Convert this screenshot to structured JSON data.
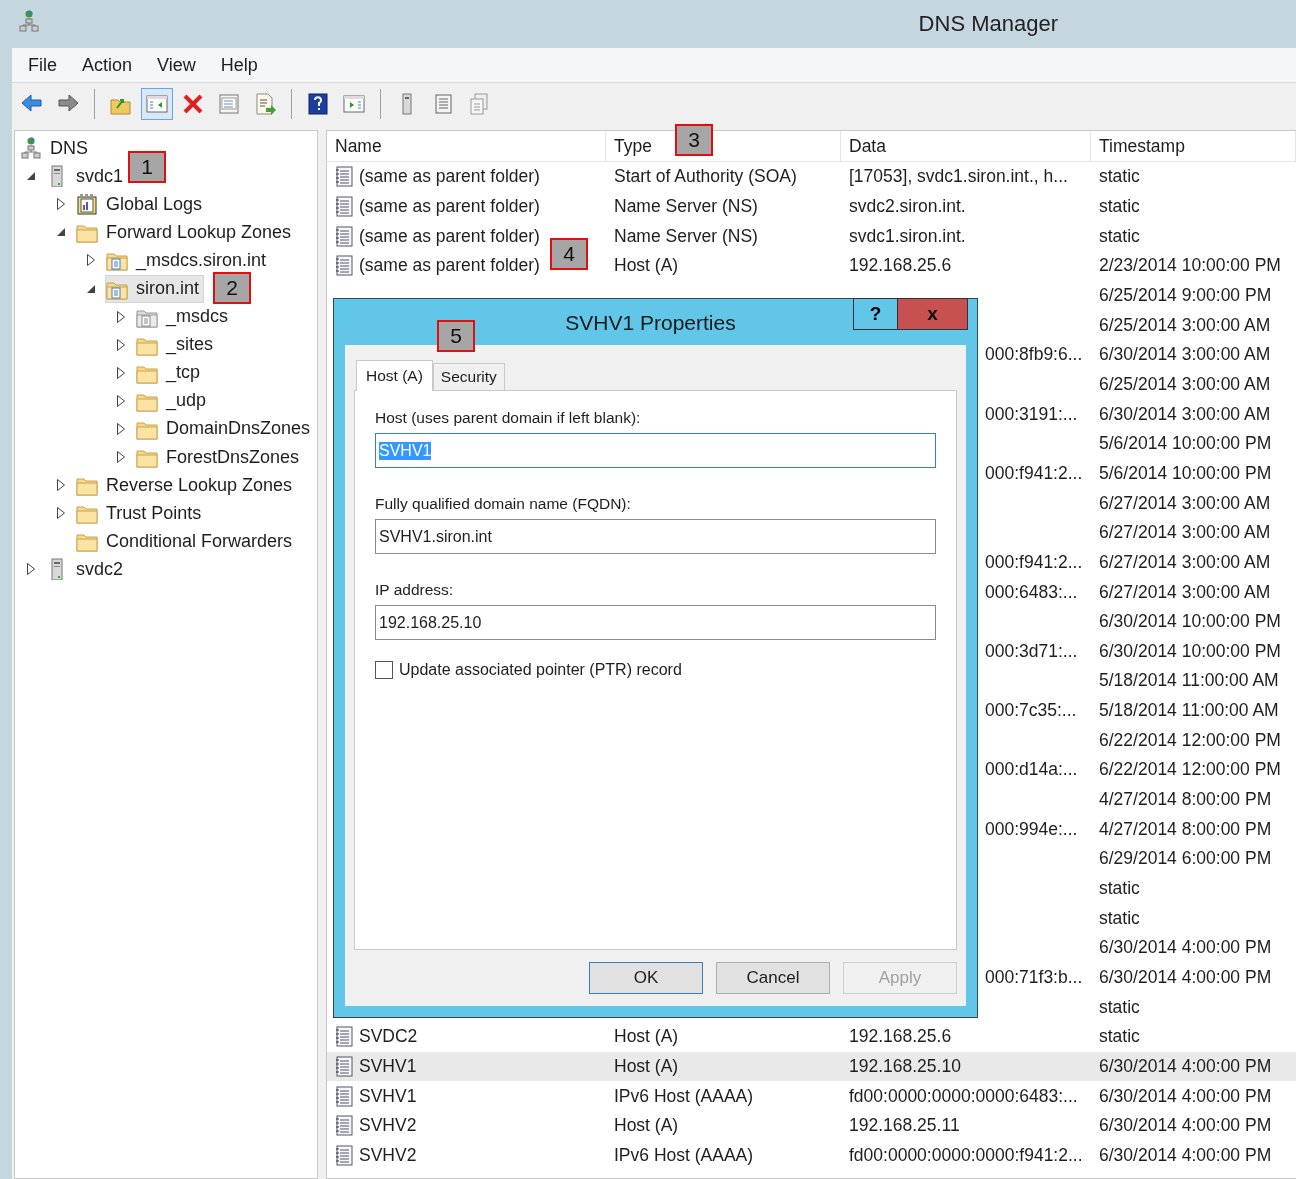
{
  "window": {
    "title": "DNS Manager"
  },
  "menu": [
    "File",
    "Action",
    "View",
    "Help"
  ],
  "toolbar": [
    [
      {
        "pressed": false
      },
      {
        "pressed": false
      }
    ],
    [
      {
        "pressed": false
      },
      {
        "pressed": true
      },
      {
        "pressed": false
      },
      {
        "pressed": false
      },
      {
        "pressed": false
      }
    ],
    [
      {
        "pressed": false
      },
      {
        "pressed": false
      }
    ],
    [
      {
        "pressed": false
      },
      {
        "pressed": false
      },
      {
        "pressed": false
      }
    ]
  ],
  "tree": [
    {
      "label": "DNS",
      "kind": "dns",
      "selected": false,
      "children": [
        {
          "label": "svdc1",
          "kind": "server",
          "expanded": true,
          "selected": false,
          "children": [
            {
              "label": "Global Logs",
              "kind": "log",
              "expanded": false,
              "selected": false
            },
            {
              "label": "Forward Lookup Zones",
              "kind": "folder",
              "expanded": true,
              "selected": false,
              "children": [
                {
                  "label": "_msdcs.siron.int",
                  "kind": "zone",
                  "expanded": false,
                  "selected": false
                },
                {
                  "label": "siron.int",
                  "kind": "zone",
                  "expanded": true,
                  "selected": true,
                  "children": [
                    {
                      "label": "_msdcs",
                      "kind": "delegation",
                      "expanded": false,
                      "selected": false
                    },
                    {
                      "label": "_sites",
                      "kind": "folder",
                      "expanded": false,
                      "selected": false
                    },
                    {
                      "label": "_tcp",
                      "kind": "folder",
                      "expanded": false,
                      "selected": false
                    },
                    {
                      "label": "_udp",
                      "kind": "folder",
                      "expanded": false,
                      "selected": false
                    },
                    {
                      "label": "DomainDnsZones",
                      "kind": "folder",
                      "expanded": false,
                      "selected": false
                    },
                    {
                      "label": "ForestDnsZones",
                      "kind": "folder",
                      "expanded": false,
                      "selected": false
                    }
                  ]
                }
              ]
            },
            {
              "label": "Reverse Lookup Zones",
              "kind": "folder",
              "expanded": false,
              "selected": false
            },
            {
              "label": "Trust Points",
              "kind": "folder",
              "expanded": false,
              "selected": false
            },
            {
              "label": "Conditional Forwarders",
              "kind": "folder",
              "selected": false
            }
          ]
        },
        {
          "label": "svdc2",
          "kind": "server",
          "expanded": false,
          "selected": false
        }
      ]
    }
  ],
  "table": {
    "columns": [
      "Name",
      "Type",
      "Data",
      "Timestamp"
    ],
    "rows": [
      {
        "name": "(same as parent folder)",
        "type": "Start of Authority (SOA)",
        "data": "[17053], svdc1.siron.int., h...",
        "timestamp": "static",
        "selected": false
      },
      {
        "name": "(same as parent folder)",
        "type": "Name Server (NS)",
        "data": "svdc2.siron.int.",
        "timestamp": "static",
        "selected": false
      },
      {
        "name": "(same as parent folder)",
        "type": "Name Server (NS)",
        "data": "svdc1.siron.int.",
        "timestamp": "static",
        "selected": false
      },
      {
        "name": "(same as parent folder)",
        "type": "Host (A)",
        "data": "192.168.25.6",
        "timestamp": "2/23/2014 10:00:00 PM",
        "selected": false
      },
      {
        "timestamp": "6/25/2014 9:00:00 PM",
        "selected": false
      },
      {
        "timestamp": "6/25/2014 3:00:00 AM",
        "selected": false
      },
      {
        "data": "000:8fb9:6...",
        "timestamp": "6/30/2014 3:00:00 AM",
        "selected": false
      },
      {
        "timestamp": "6/25/2014 3:00:00 AM",
        "selected": false
      },
      {
        "data": "000:3191:...",
        "timestamp": "6/30/2014 3:00:00 AM",
        "selected": false
      },
      {
        "timestamp": "5/6/2014 10:00:00 PM",
        "selected": false
      },
      {
        "data": "000:f941:2...",
        "timestamp": "5/6/2014 10:00:00 PM",
        "selected": false
      },
      {
        "timestamp": "6/27/2014 3:00:00 AM",
        "selected": false
      },
      {
        "timestamp": "6/27/2014 3:00:00 AM",
        "selected": false
      },
      {
        "data": "000:f941:2...",
        "timestamp": "6/27/2014 3:00:00 AM",
        "selected": false
      },
      {
        "data": "000:6483:...",
        "timestamp": "6/27/2014 3:00:00 AM",
        "selected": false
      },
      {
        "timestamp": "6/30/2014 10:00:00 PM",
        "selected": false
      },
      {
        "data": "000:3d71:...",
        "timestamp": "6/30/2014 10:00:00 PM",
        "selected": false
      },
      {
        "timestamp": "5/18/2014 11:00:00 AM",
        "selected": false
      },
      {
        "data": "000:7c35:...",
        "timestamp": "5/18/2014 11:00:00 AM",
        "selected": false
      },
      {
        "timestamp": "6/22/2014 12:00:00 PM",
        "selected": false
      },
      {
        "data": "000:d14a:...",
        "timestamp": "6/22/2014 12:00:00 PM",
        "selected": false
      },
      {
        "timestamp": "4/27/2014 8:00:00 PM",
        "selected": false
      },
      {
        "data": "000:994e:...",
        "timestamp": "4/27/2014 8:00:00 PM",
        "selected": false
      },
      {
        "timestamp": "6/29/2014 6:00:00 PM",
        "selected": false
      },
      {
        "timestamp": "static",
        "selected": false
      },
      {
        "timestamp": "static",
        "selected": false
      },
      {
        "timestamp": "6/30/2014 4:00:00 PM",
        "selected": false
      },
      {
        "data": "000:71f3:b...",
        "timestamp": "6/30/2014 4:00:00 PM",
        "selected": false
      },
      {
        "timestamp": "static",
        "selected": false
      },
      {
        "name": "SVDC2",
        "type": "Host (A)",
        "data": "192.168.25.6",
        "timestamp": "static",
        "selected": false
      },
      {
        "name": "SVHV1",
        "type": "Host (A)",
        "data": "192.168.25.10",
        "timestamp": "6/30/2014 4:00:00 PM",
        "selected": true
      },
      {
        "name": "SVHV1",
        "type": "IPv6 Host (AAAA)",
        "data": "fd00:0000:0000:0000:6483:...",
        "timestamp": "6/30/2014 4:00:00 PM",
        "selected": false
      },
      {
        "name": "SVHV2",
        "type": "Host (A)",
        "data": "192.168.25.11",
        "timestamp": "6/30/2014 4:00:00 PM",
        "selected": false
      },
      {
        "name": "SVHV2",
        "type": "IPv6 Host (AAAA)",
        "data": "fd00:0000:0000:0000:f941:2...",
        "timestamp": "6/30/2014 4:00:00 PM",
        "selected": false
      }
    ]
  },
  "dialog": {
    "title": "SVHV1 Properties",
    "help_button": "?",
    "close_button": "x",
    "tabs": [
      {
        "label": "Host (A)",
        "selected": true
      },
      {
        "label": "Security",
        "selected": false
      }
    ],
    "fields": [
      {
        "label": "Host (uses parent domain if left blank):",
        "value": "SVHV1",
        "focused": true
      },
      {
        "label": "Fully qualified domain name (FQDN):",
        "value": "SVHV1.siron.int",
        "focused": false
      },
      {
        "label": "IP address:",
        "value": "192.168.25.10",
        "focused": false
      }
    ],
    "checkbox": {
      "label": "Update associated pointer (PTR) record",
      "checked": false
    },
    "buttons": [
      {
        "label": "OK",
        "default": true,
        "disabled": false
      },
      {
        "label": "Cancel",
        "default": false,
        "disabled": false
      },
      {
        "label": "Apply",
        "default": false,
        "disabled": true
      }
    ]
  },
  "callouts": [
    {
      "label": "1"
    },
    {
      "label": "2"
    },
    {
      "label": "3"
    },
    {
      "label": "4"
    },
    {
      "label": "5"
    }
  ]
}
